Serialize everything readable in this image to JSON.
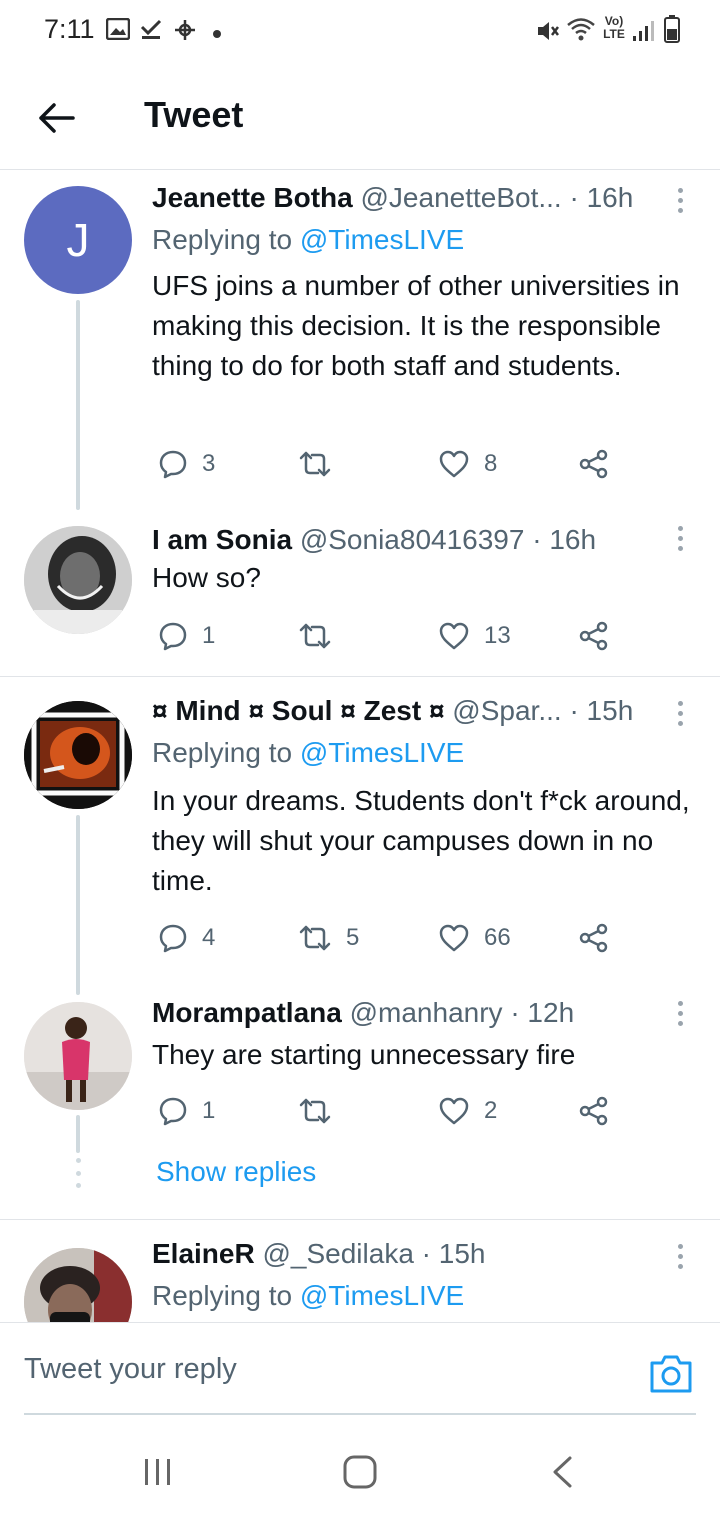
{
  "status_bar": {
    "time": "7:11",
    "network_label": "Vo) LTE"
  },
  "header": {
    "title": "Tweet"
  },
  "tweets": [
    {
      "name": "Jeanette Botha",
      "handle": "@JeanetteBot...",
      "time": "· 16h",
      "replying_prefix": "Replying to ",
      "replying_to": "@TimesLIVE",
      "text": "UFS joins a number of other universities in making this decision. It is the responsible thing to do for both staff and students.",
      "replies": "3",
      "retweets": "",
      "likes": "8",
      "avatar_letter": "J",
      "avatar_color": "#5c6bc0"
    },
    {
      "name": "I am Sonia",
      "handle": "@Sonia80416397",
      "time": "· 16h",
      "text": "How so?",
      "replies": "1",
      "retweets": "",
      "likes": "13"
    },
    {
      "name": "¤ Mind ¤ Soul ¤ Zest ¤",
      "handle": "@Spar...",
      "time": "· 15h",
      "replying_prefix": "Replying to ",
      "replying_to": "@TimesLIVE",
      "text": "In your dreams. Students don't f*ck around, they will shut your campuses down in no time.",
      "replies": "4",
      "retweets": "5",
      "likes": "66"
    },
    {
      "name": "Morampatlana",
      "handle": "@manhanry",
      "time": "· 12h",
      "text": "They are starting unnecessary fire",
      "replies": "1",
      "retweets": "",
      "likes": "2"
    },
    {
      "name": "ElaineR",
      "handle": "@_Sedilaka",
      "time": "· 15h",
      "replying_prefix": "Replying to ",
      "replying_to": "@TimesLIVE"
    }
  ],
  "show_replies_label": "Show replies",
  "reply_bar": {
    "placeholder": "Tweet your reply"
  },
  "icons": {
    "back": "arrow-left-icon",
    "more": "more-vertical-icon",
    "reply": "comment-icon",
    "retweet": "retweet-icon",
    "like": "heart-icon",
    "share": "share-icon",
    "camera": "camera-icon"
  },
  "colors": {
    "accent": "#1d9bf0",
    "text_secondary": "#536471",
    "thread_line": "#cfd9de"
  }
}
